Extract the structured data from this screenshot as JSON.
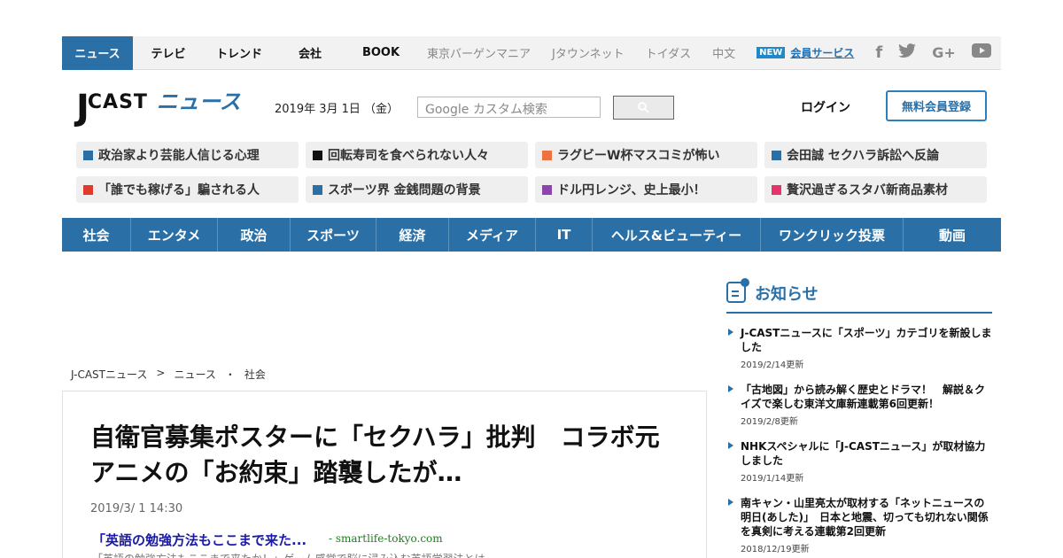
{
  "topbar": {
    "main_tabs": [
      {
        "label": "ニュース",
        "active": true
      },
      {
        "label": "テレビ"
      },
      {
        "label": "トレンド"
      },
      {
        "label": "会社"
      },
      {
        "label": "BOOK"
      }
    ],
    "sub_tabs": [
      "東京バーゲンマニア",
      "Jタウンネット",
      "トイダス",
      "中文"
    ],
    "new_badge": "NEW",
    "member_service": "会員サービス",
    "social_icons": [
      "facebook-icon",
      "twitter-icon",
      "google-plus-icon",
      "youtube-icon"
    ]
  },
  "header": {
    "logo_j": "J",
    "logo_cast": "CAST",
    "logo_news": "ニュース",
    "date": "2019年 3月 1日 （金）",
    "search_placeholder": "Google カスタム検索",
    "login": "ログイン",
    "register": "無料会員登録"
  },
  "trending": [
    {
      "label": "政治家より芸能人信じる心理",
      "color": "#2a70a6"
    },
    {
      "label": "回転寿司を食べられない人々",
      "color": "#111111"
    },
    {
      "label": "ラグビーW杯マスコミが怖い",
      "color": "#f07040"
    },
    {
      "label": "会田誠 セクハラ訴訟へ反論",
      "color": "#2a70a6"
    },
    {
      "label": "「誰でも稼げる」騙される人",
      "color": "#e03a2a"
    },
    {
      "label": "スポーツ界 金銭問題の背景",
      "color": "#2a70a6"
    },
    {
      "label": "ドル円レンジ、史上最小！",
      "color": "#8e44ad"
    },
    {
      "label": "贅沢過ぎるスタバ新商品素材",
      "color": "#e8336a"
    }
  ],
  "categories": [
    "社会",
    "エンタメ",
    "政治",
    "スポーツ",
    "経済",
    "メディア",
    "IT",
    "ヘルス&ビューティー",
    "ワンクリック投票",
    "動画"
  ],
  "breadcrumb": [
    "J-CASTニュース",
    ">",
    "ニュース",
    "・",
    "社会"
  ],
  "article": {
    "title": "自衛官募集ポスターに「セクハラ」批判　コラボ元アニメの「お約束」踏襲したが…",
    "time": "2019/3/ 1 14:30",
    "ad_title": "「英語の勉強方法もここまで来た...",
    "ad_src": "-  smartlife-tokyo.com",
    "ad_desc": "「英語の勉強方法もここまで来たか！」ゲーム感覚で脳に浸み込む英語学習法とは"
  },
  "sidebar": {
    "title": "お知らせ",
    "news": [
      {
        "title": "J-CASTニュースに「スポーツ」カテゴリを新設しました",
        "date": "2019/2/14更新"
      },
      {
        "title": "「古地図」から読み解く歴史とドラマ！　解説＆クイズで楽しむ東洋文庫新連載第6回更新！",
        "date": "2019/2/8更新"
      },
      {
        "title": "NHKスペシャルに「J-CASTニュース」が取材協力しました",
        "date": "2019/1/14更新"
      },
      {
        "title": "南キャン・山里亮太が取材する「ネットニュースの明日(あした)」　日本と地震、切っても切れない関係を真剣に考える連載第2回更新",
        "date": "2018/12/19更新"
      }
    ]
  }
}
